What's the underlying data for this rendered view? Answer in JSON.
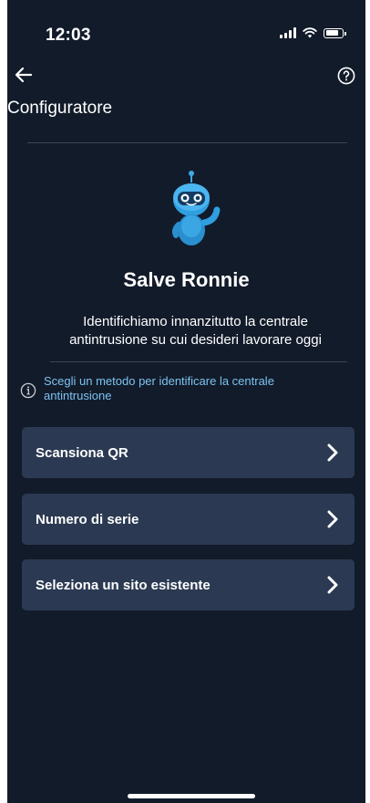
{
  "status_bar": {
    "time": "12:03",
    "icons": [
      "signal-icon",
      "wifi-icon",
      "battery-icon"
    ]
  },
  "nav": {
    "back_icon": "arrow-left-icon",
    "help_icon": "question-circle-icon",
    "title": "Configuratore"
  },
  "robot": {
    "icon": "robot-avatar"
  },
  "greeting": "Salve Ronnie",
  "intro": "Identifichiamo innanzitutto la centrale antintrusione su cui desideri lavorare oggi",
  "hint": {
    "icon": "info-icon",
    "text": "Scegli un metodo per identificare la centrale antintrusione"
  },
  "options": [
    {
      "label": "Scansiona QR"
    },
    {
      "label": "Numero di serie"
    },
    {
      "label": "Seleziona un sito esistente"
    }
  ],
  "colors": {
    "background": "#121b2a",
    "card": "#2b3a52",
    "accent": "#7cc3f0",
    "divider": "#3a4458"
  }
}
